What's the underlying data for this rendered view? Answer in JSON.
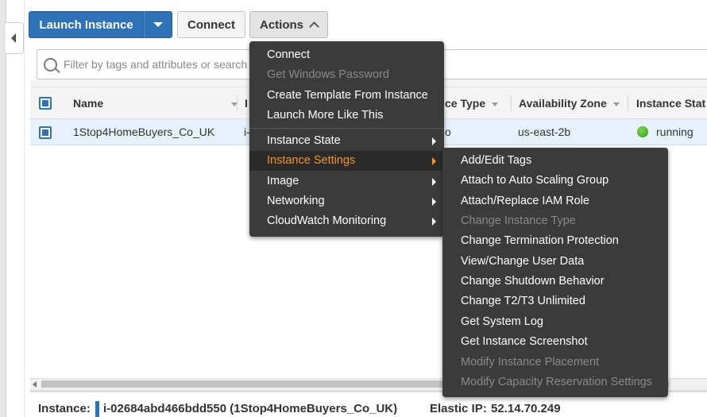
{
  "toolbar": {
    "launch_label": "Launch Instance",
    "connect_label": "Connect",
    "actions_label": "Actions"
  },
  "filter": {
    "placeholder": "Filter by tags and attributes or search by keyword"
  },
  "table": {
    "columns": [
      "Name",
      "Instance ID",
      "Instance Type",
      "Availability Zone",
      "Instance State"
    ],
    "column_visible": [
      "Name",
      "I",
      "ce Type",
      "Availability Zone",
      "Instance Stat"
    ],
    "row": {
      "name": "1Stop4HomeBuyers_Co_UK",
      "id_visible": "i-",
      "type_visible": "o",
      "zone": "us-east-2b",
      "state": "running",
      "state_color": "#3aa91e"
    }
  },
  "actions_menu": {
    "items": [
      {
        "label": "Connect",
        "disabled": false
      },
      {
        "label": "Get Windows Password",
        "disabled": true
      },
      {
        "label": "Create Template From Instance",
        "disabled": false
      },
      {
        "label": "Launch More Like This",
        "disabled": false
      },
      {
        "label": "Instance State",
        "submenu": true
      },
      {
        "label": "Instance Settings",
        "submenu": true,
        "active": true
      },
      {
        "label": "Image",
        "submenu": true
      },
      {
        "label": "Networking",
        "submenu": true
      },
      {
        "label": "CloudWatch Monitoring",
        "submenu": true
      }
    ]
  },
  "settings_menu": {
    "items": [
      {
        "label": "Add/Edit Tags",
        "disabled": false
      },
      {
        "label": "Attach to Auto Scaling Group",
        "disabled": false
      },
      {
        "label": "Attach/Replace IAM Role",
        "disabled": false
      },
      {
        "label": "Change Instance Type",
        "disabled": true
      },
      {
        "label": "Change Termination Protection",
        "disabled": false
      },
      {
        "label": "View/Change User Data",
        "disabled": false
      },
      {
        "label": "Change Shutdown Behavior",
        "disabled": false
      },
      {
        "label": "Change T2/T3 Unlimited",
        "disabled": false
      },
      {
        "label": "Get System Log",
        "disabled": false
      },
      {
        "label": "Get Instance Screenshot",
        "disabled": false
      },
      {
        "label": "Modify Instance Placement",
        "disabled": true
      },
      {
        "label": "Modify Capacity Reservation Settings",
        "disabled": true
      }
    ]
  },
  "details": {
    "instance_label": "Instance:",
    "instance_value": "i-02684abd466bdd550 (1Stop4HomeBuyers_Co_UK)",
    "eip_label": "Elastic IP:",
    "eip_value": "52.14.70.249"
  },
  "colors": {
    "primary": "#2e73b8",
    "menu_bg": "#3b3b3b",
    "menu_active": "#f7941d",
    "row_selected": "#e7f1fb"
  }
}
